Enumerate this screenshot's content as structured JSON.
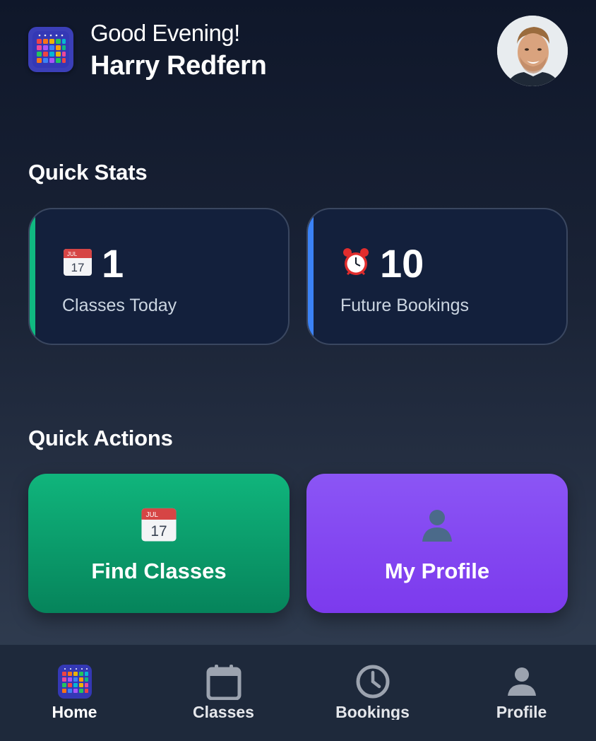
{
  "header": {
    "greeting": "Good Evening!",
    "user_name": "Harry Redfern",
    "app_logo_icon": "calendar-grid-app-icon",
    "avatar_icon": "user-avatar-photo"
  },
  "quick_stats": {
    "title": "Quick Stats",
    "cards": [
      {
        "icon": "calendar-icon",
        "value": "1",
        "label": "Classes Today",
        "accent": "#10b981"
      },
      {
        "icon": "alarm-clock-icon",
        "value": "10",
        "label": "Future Bookings",
        "accent": "#3b82f6"
      }
    ]
  },
  "quick_actions": {
    "title": "Quick Actions",
    "actions": [
      {
        "icon": "calendar-icon",
        "label": "Find Classes",
        "color": "#10b981"
      },
      {
        "icon": "user-silhouette-icon",
        "label": "My Profile",
        "color": "#8b5cf6"
      }
    ]
  },
  "bottom_nav": {
    "items": [
      {
        "label": "Home",
        "icon": "app-grid-icon",
        "active": true
      },
      {
        "label": "Classes",
        "icon": "calendar-outline-icon",
        "active": false
      },
      {
        "label": "Bookings",
        "icon": "clock-icon",
        "active": false
      },
      {
        "label": "Profile",
        "icon": "person-icon",
        "active": false
      }
    ]
  },
  "colors": {
    "background_top": "#0f172a",
    "card_bg": "#13203c",
    "nav_bg": "#1e293b",
    "green_accent": "#10b981",
    "blue_accent": "#3b82f6",
    "purple": "#8b5cf6"
  }
}
